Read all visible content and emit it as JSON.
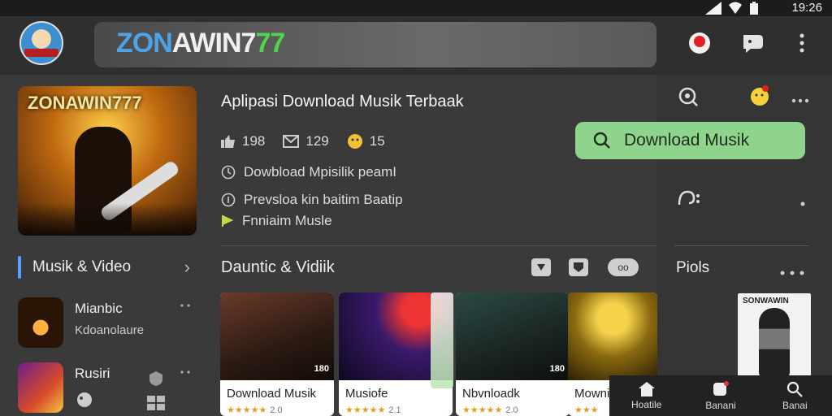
{
  "status_bar": {
    "time": "19:26"
  },
  "header": {
    "brand_part1": "ZON",
    "brand_part2": "AWIN7",
    "brand_part3": "77"
  },
  "app": {
    "hero_title": "ZONAWIN777",
    "title": "Aplipasi Download Musik Terbaak",
    "stat_likes": "198",
    "stat_mails": "129",
    "stat_emoji": "15",
    "line1": "Dowbload Mpisilik peamI",
    "line2": "Prevsloa kin baitim Baatip",
    "line3": "Fnniaim Musle",
    "download_button": "Download Musik"
  },
  "sidebar": {
    "category": "Musik & Video",
    "apps": [
      {
        "name": "Mianbic",
        "sub": "Kdoanolaure"
      },
      {
        "name": "Rusiri",
        "sub": ""
      }
    ]
  },
  "section": {
    "title": "Dauntic & Vidiik",
    "ctrl_label": "oo"
  },
  "cards": [
    {
      "label": "Download Musik",
      "rating": "2.0",
      "badge": "180"
    },
    {
      "label": "Musiofe",
      "rating": "2.1",
      "badge": ""
    },
    {
      "label": "Nbvnloadk",
      "rating": "2.0",
      "badge": "180"
    },
    {
      "label": "Mowni",
      "rating": "",
      "badge": ""
    }
  ],
  "right_panel": {
    "section_label": "Piols",
    "poster_title": "SONWAWIN"
  },
  "bottom_nav": [
    {
      "label": "Hoatile",
      "icon": "home-icon"
    },
    {
      "label": "Banani",
      "icon": "apps-icon"
    },
    {
      "label": "Banai",
      "icon": "search-icon"
    }
  ],
  "colors": {
    "accent_green": "#8fd48c",
    "brand_blue": "#4da3e8",
    "brand_green": "#52d34c",
    "background": "#3a3a3a"
  }
}
